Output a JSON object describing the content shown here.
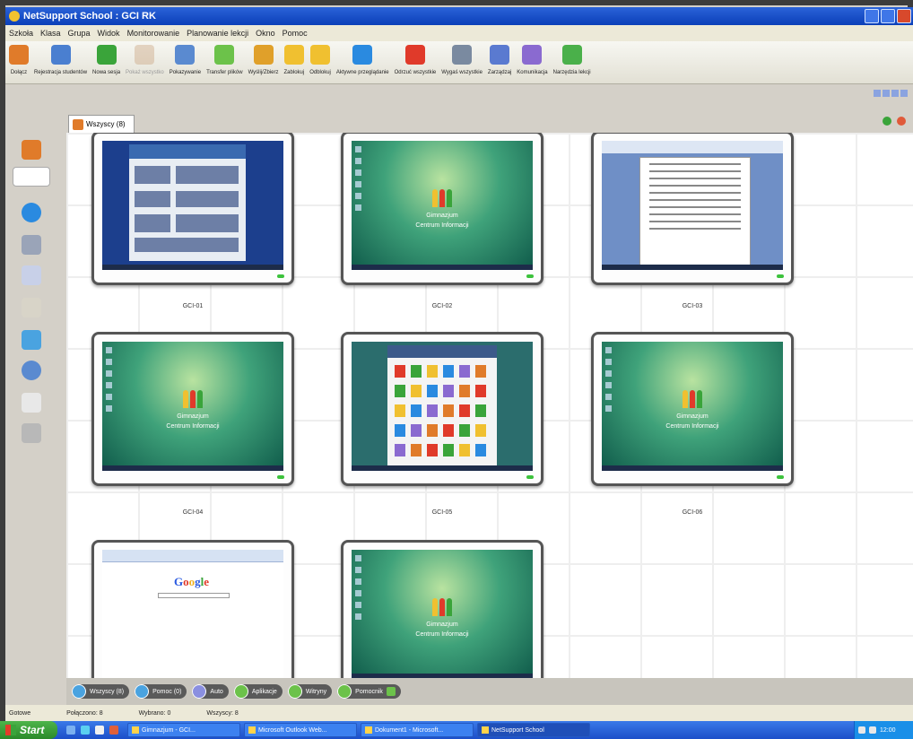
{
  "window": {
    "title": "NetSupport School : GCI RK"
  },
  "menu": [
    "Szkoła",
    "Klasa",
    "Grupa",
    "Widok",
    "Monitorowanie",
    "Planowanie lekcji",
    "Okno",
    "Pomoc"
  ],
  "toolbar": [
    {
      "label": "Dołącz",
      "icon": "students-icon",
      "color": "#e07b2a",
      "disabled": false
    },
    {
      "label": "Rejestracja studentów",
      "icon": "register-icon",
      "color": "#4a7fd0",
      "disabled": false
    },
    {
      "label": "Nowa sesja",
      "icon": "play-icon",
      "color": "#3aa43a",
      "disabled": false
    },
    {
      "label": "Pokaż wszystko",
      "icon": "show-icon",
      "color": "#c8a07a",
      "disabled": true
    },
    {
      "label": "Pokazywanie",
      "icon": "show-student-icon",
      "color": "#5a8ad0",
      "disabled": false
    },
    {
      "label": "Transfer plików",
      "icon": "file-transfer-icon",
      "color": "#6cc24a",
      "disabled": false
    },
    {
      "label": "Wyślij/Zbierz",
      "icon": "send-collect-icon",
      "color": "#e0a02a",
      "disabled": false
    },
    {
      "label": "Zablokuj",
      "icon": "lock-icon",
      "color": "#f0c030",
      "disabled": false
    },
    {
      "label": "Odblokuj",
      "icon": "unlock-icon",
      "color": "#f0c030",
      "disabled": false
    },
    {
      "label": "Aktywne przeglądanie",
      "icon": "globe-icon",
      "color": "#2a8ae0",
      "disabled": false
    },
    {
      "label": "Odrzuć wszystkie",
      "icon": "block-icon",
      "color": "#e03a2a",
      "disabled": false
    },
    {
      "label": "Wygaś wszystkie",
      "icon": "monitor-off-icon",
      "color": "#7a8aa0",
      "disabled": false
    },
    {
      "label": "Zarządzaj",
      "icon": "manage-icon",
      "color": "#5a7ad0",
      "disabled": false
    },
    {
      "label": "Komunikacja",
      "icon": "chat-icon",
      "color": "#8a6ad0",
      "disabled": false
    },
    {
      "label": "Narzędzia lekcji",
      "icon": "tools-icon",
      "color": "#4ab04a",
      "disabled": false
    }
  ],
  "group_tab": {
    "label": "Wszyscy (8)"
  },
  "students": [
    {
      "name": "GCI-01",
      "screen": "browser"
    },
    {
      "name": "GCI-02",
      "screen": "desktop"
    },
    {
      "name": "GCI-03",
      "screen": "word"
    },
    {
      "name": "GCI-04",
      "screen": "desktop"
    },
    {
      "name": "GCI-05",
      "screen": "shop"
    },
    {
      "name": "GCI-06",
      "screen": "desktop"
    },
    {
      "name": "",
      "screen": "google"
    },
    {
      "name": "",
      "screen": "desktop"
    }
  ],
  "desktop_wallpaper": {
    "line1": "Gimnazjum",
    "line2": "Centrum Informacji"
  },
  "google_logo": "Google",
  "bottom_pills": [
    {
      "label": "Wszyscy (8)",
      "icon": "group-icon"
    },
    {
      "label": "Pomoc (0)",
      "icon": "help-icon"
    },
    {
      "label": "Auto",
      "icon": "auto-icon"
    },
    {
      "label": "Aplikacje",
      "icon": "apps-icon"
    },
    {
      "label": "Witryny",
      "icon": "websites-icon"
    },
    {
      "label": "Pomocnik",
      "icon": "assistant-icon"
    }
  ],
  "status": {
    "ready": "Gotowe",
    "connected": "Połączono: 8",
    "selected": "Wybrano: 0",
    "group": "Wszyscy: 8"
  },
  "taskbar": {
    "start": "Start",
    "tasks": [
      {
        "label": "Gimnazjum - GCI...",
        "active": false
      },
      {
        "label": "Microsoft Outlook Web...",
        "active": false
      },
      {
        "label": "Dokument1 - Microsoft...",
        "active": false
      },
      {
        "label": "NetSupport School",
        "active": true
      }
    ],
    "clock": "12:00"
  }
}
